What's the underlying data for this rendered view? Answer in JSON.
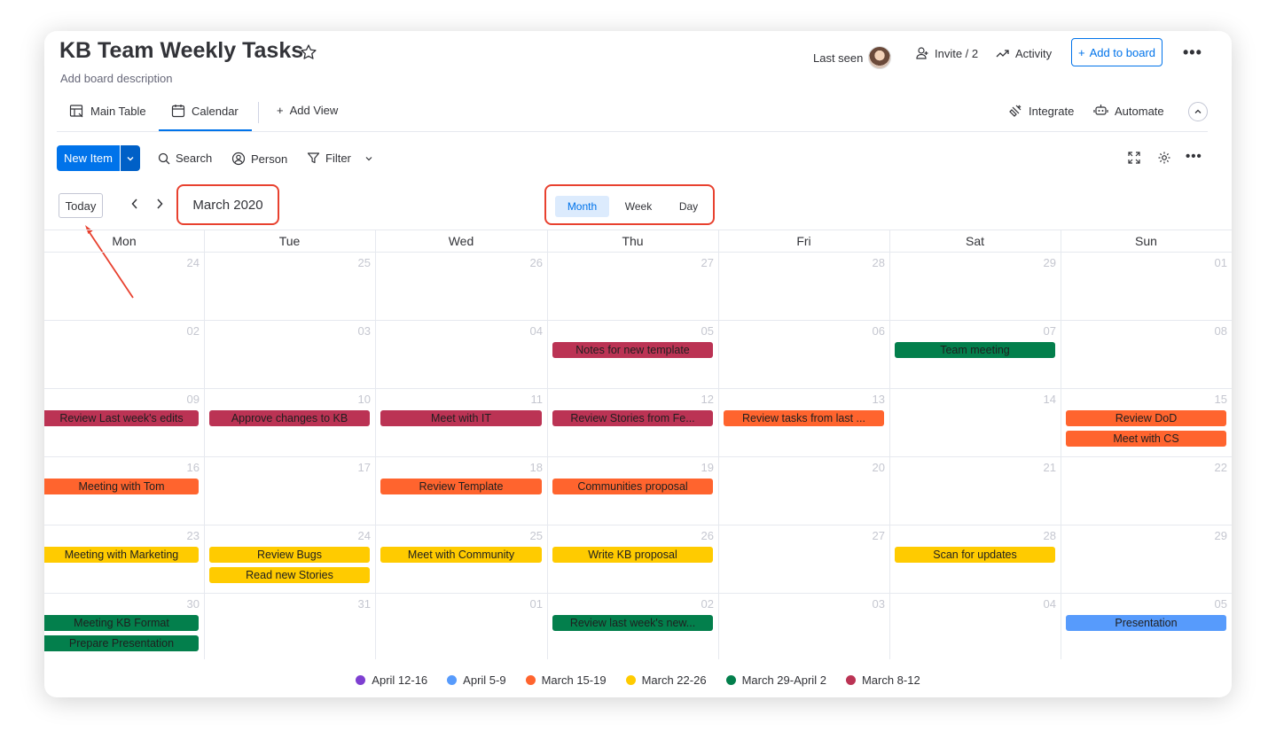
{
  "header": {
    "title": "KB Team Weekly Tasks",
    "description": "Add board description",
    "last_seen": "Last seen",
    "invite": "Invite / 2",
    "activity": "Activity",
    "add_to_board": "Add to board"
  },
  "tabs": {
    "main_table": "Main Table",
    "calendar": "Calendar",
    "add_view": "Add View",
    "integrate": "Integrate",
    "automate": "Automate"
  },
  "toolbar": {
    "new_item": "New Item",
    "search": "Search",
    "person": "Person",
    "filter": "Filter"
  },
  "calendar": {
    "today": "Today",
    "month_label": "March 2020",
    "views": [
      "Month",
      "Week",
      "Day"
    ],
    "active_view": "Month",
    "weekdays": [
      "Mon",
      "Tue",
      "Wed",
      "Thu",
      "Fri",
      "Sat",
      "Sun"
    ],
    "weeks": [
      [
        "24",
        "25",
        "26",
        "27",
        "28",
        "29",
        "01"
      ],
      [
        "02",
        "03",
        "04",
        "05",
        "06",
        "07",
        "08"
      ],
      [
        "09",
        "10",
        "11",
        "12",
        "13",
        "14",
        "15"
      ],
      [
        "16",
        "17",
        "18",
        "19",
        "20",
        "21",
        "22"
      ],
      [
        "23",
        "24",
        "25",
        "26",
        "27",
        "28",
        "29"
      ],
      [
        "30",
        "31",
        "01",
        "02",
        "03",
        "04",
        "05"
      ]
    ],
    "events": [
      {
        "week": 1,
        "day": 3,
        "slot": 0,
        "label": "Notes for new template",
        "group": "March 8-12"
      },
      {
        "week": 1,
        "day": 5,
        "slot": 0,
        "label": "Team meeting",
        "group": "March 29-April 2"
      },
      {
        "week": 2,
        "day": 0,
        "slot": 0,
        "label": "Review Last week's edits",
        "group": "March 8-12"
      },
      {
        "week": 2,
        "day": 1,
        "slot": 0,
        "label": "Approve changes to KB",
        "group": "March 8-12"
      },
      {
        "week": 2,
        "day": 2,
        "slot": 0,
        "label": "Meet with IT",
        "group": "March 8-12"
      },
      {
        "week": 2,
        "day": 3,
        "slot": 0,
        "label": "Review Stories from Fe...",
        "group": "March 8-12"
      },
      {
        "week": 2,
        "day": 4,
        "slot": 0,
        "label": "Review tasks from last ...",
        "group": "March 15-19"
      },
      {
        "week": 2,
        "day": 6,
        "slot": 0,
        "label": "Review DoD",
        "group": "March 15-19"
      },
      {
        "week": 2,
        "day": 6,
        "slot": 1,
        "label": "Meet with CS",
        "group": "March 15-19"
      },
      {
        "week": 3,
        "day": 0,
        "slot": 0,
        "label": "Meeting with Tom",
        "group": "March 15-19"
      },
      {
        "week": 3,
        "day": 2,
        "slot": 0,
        "label": "Review Template",
        "group": "March 15-19"
      },
      {
        "week": 3,
        "day": 3,
        "slot": 0,
        "label": "Communities proposal",
        "group": "March 15-19"
      },
      {
        "week": 4,
        "day": 0,
        "slot": 0,
        "label": "Meeting with Marketing",
        "group": "March 22-26"
      },
      {
        "week": 4,
        "day": 1,
        "slot": 0,
        "label": "Review Bugs",
        "group": "March 22-26"
      },
      {
        "week": 4,
        "day": 1,
        "slot": 1,
        "label": "Read new Stories",
        "group": "March 22-26"
      },
      {
        "week": 4,
        "day": 2,
        "slot": 0,
        "label": "Meet with Community",
        "group": "March 22-26"
      },
      {
        "week": 4,
        "day": 3,
        "slot": 0,
        "label": "Write KB proposal",
        "group": "March 22-26"
      },
      {
        "week": 4,
        "day": 5,
        "slot": 0,
        "label": "Scan for updates",
        "group": "March 22-26"
      },
      {
        "week": 5,
        "day": 0,
        "slot": 0,
        "label": "Meeting KB Format",
        "group": "March 29-April 2"
      },
      {
        "week": 5,
        "day": 0,
        "slot": 1,
        "label": "Prepare Presentation",
        "group": "March 29-April 2"
      },
      {
        "week": 5,
        "day": 3,
        "slot": 0,
        "label": "Review last week's new...",
        "group": "March 29-April 2"
      },
      {
        "week": 5,
        "day": 6,
        "slot": 0,
        "label": "Presentation",
        "group": "April 5-9"
      }
    ]
  },
  "legend": [
    {
      "label": "April 12-16",
      "color": "#7e3fd1"
    },
    {
      "label": "April 5-9",
      "color": "#579bfc"
    },
    {
      "label": "March 15-19",
      "color": "#ff642e"
    },
    {
      "label": "March 22-26",
      "color": "#ffcb00"
    },
    {
      "label": "March 29-April 2",
      "color": "#037f4c"
    },
    {
      "label": "March 8-12",
      "color": "#bb3354"
    }
  ],
  "colors": {
    "accent": "#0073ea",
    "annotation": "#e8412f"
  }
}
